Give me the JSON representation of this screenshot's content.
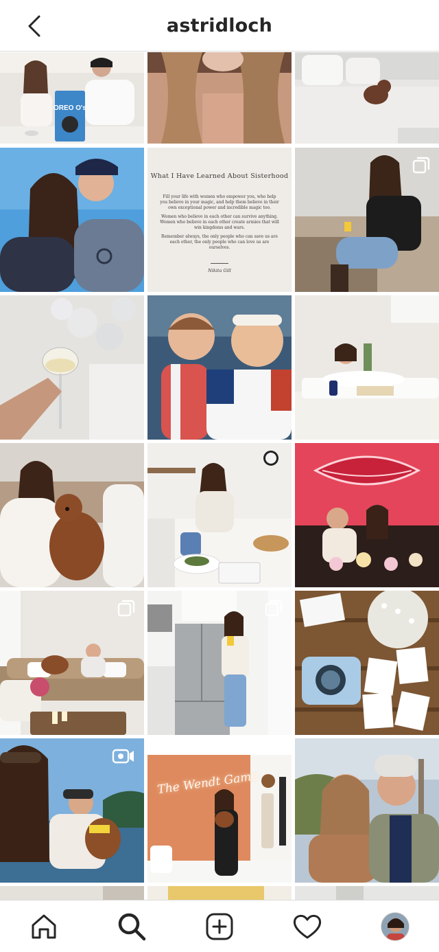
{
  "header": {
    "title": "astridloch",
    "back_icon": "chevron-left-icon"
  },
  "quote": {
    "title": "What I Have Learned About Sisterhood",
    "paragraphs": [
      "Fill your life with women who empower you, who help you believe in your magic, and help them believe in their own exceptional power and incredible magic too.",
      "Women who believe in each other can survive anything. Women who believe in each other create armies that will win kingdoms and wars.",
      "Remember always, the only people who can save us are each other, the only people who can love us are ourselves."
    ],
    "author": "Nikita Gill"
  },
  "neon_sign": "The Wendt Game",
  "cereal_box": "OREO O's",
  "badges": {
    "carousel": "carousel-icon",
    "video": "video-icon"
  },
  "bottom_nav": [
    {
      "icon": "home-icon"
    },
    {
      "icon": "search-icon"
    },
    {
      "icon": "add-post-icon"
    },
    {
      "icon": "heart-icon"
    },
    {
      "icon": "profile-avatar"
    }
  ],
  "colors": {
    "text": "#262626",
    "divider": "#dbdbdb",
    "background": "#ffffff"
  }
}
